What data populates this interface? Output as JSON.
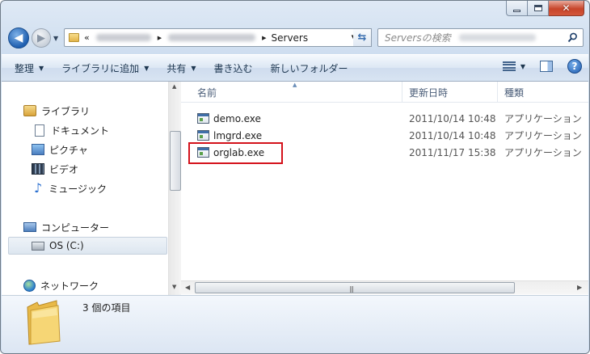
{
  "address_bar": {
    "overflow_chevron": "«",
    "crumbs": [
      "Servers"
    ]
  },
  "search": {
    "placeholder": "Serversの検索"
  },
  "toolbar": {
    "organize": "整理",
    "add_to_library": "ライブラリに追加",
    "share": "共有",
    "burn": "書き込む",
    "new_folder": "新しいフォルダー",
    "help": "?"
  },
  "sidebar": {
    "libraries": {
      "label": "ライブラリ",
      "items": [
        {
          "label": "ドキュメント",
          "icon": "document-icon"
        },
        {
          "label": "ピクチャ",
          "icon": "picture-icon"
        },
        {
          "label": "ビデオ",
          "icon": "video-icon"
        },
        {
          "label": "ミュージック",
          "icon": "music-icon"
        }
      ]
    },
    "computer": {
      "label": "コンピューター",
      "items": [
        {
          "label": "OS (C:)",
          "icon": "drive-icon",
          "selected": true
        }
      ]
    },
    "network": {
      "label": "ネットワーク"
    }
  },
  "file_list": {
    "columns": [
      "名前",
      "更新日時",
      "種類"
    ],
    "files": [
      {
        "name": "demo.exe",
        "modified": "2011/10/14 10:48",
        "type": "アプリケーション"
      },
      {
        "name": "lmgrd.exe",
        "modified": "2011/10/14 10:48",
        "type": "アプリケーション"
      },
      {
        "name": "orglab.exe",
        "modified": "2011/11/17 15:38",
        "type": "アプリケーション",
        "highlighted": true
      }
    ]
  },
  "details": {
    "item_count": "3 個の項目"
  },
  "colors": {
    "highlight": "#d4121b",
    "toolbar_text": "#1e3750",
    "header_text": "#4a5d78"
  }
}
